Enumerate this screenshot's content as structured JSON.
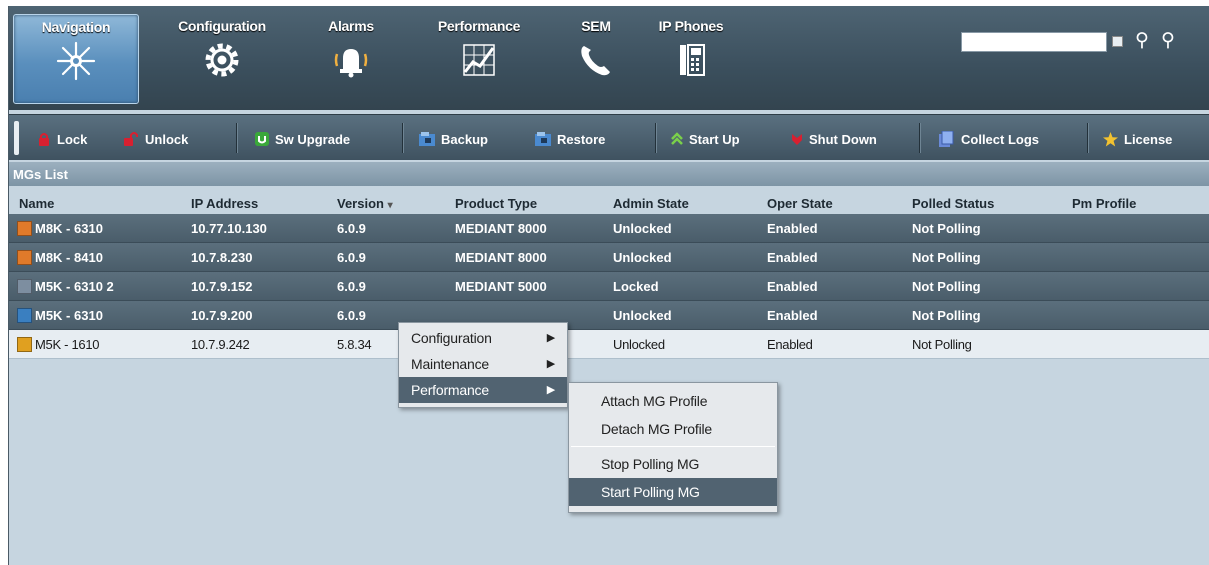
{
  "nav": {
    "tabs": [
      {
        "label": "Navigation",
        "icon": "network-star-icon",
        "active": true
      },
      {
        "label": "Configuration",
        "icon": "gear-icon",
        "active": false
      },
      {
        "label": "Alarms",
        "icon": "alarm-bell-icon",
        "active": false
      },
      {
        "label": "Performance",
        "icon": "performance-chart-icon",
        "active": false
      },
      {
        "label": "SEM",
        "icon": "phone-handset-icon",
        "active": false
      },
      {
        "label": "IP Phones",
        "icon": "ip-phone-icon",
        "active": false
      }
    ],
    "search": {
      "value": "",
      "placeholder": ""
    }
  },
  "toolbar": {
    "buttons": [
      {
        "label": "Lock",
        "icon": "lock-icon"
      },
      {
        "label": "Unlock",
        "icon": "unlock-icon"
      },
      {
        "label": "Sw Upgrade",
        "icon": "sw-upgrade-icon"
      },
      {
        "label": "Backup",
        "icon": "backup-icon"
      },
      {
        "label": "Restore",
        "icon": "restore-icon"
      },
      {
        "label": "Start Up",
        "icon": "start-up-icon"
      },
      {
        "label": "Shut Down",
        "icon": "shut-down-icon"
      },
      {
        "label": "Collect Logs",
        "icon": "collect-logs-icon"
      },
      {
        "label": "License",
        "icon": "license-star-icon"
      }
    ]
  },
  "list": {
    "title": "MGs List",
    "sort_indicator": "▾",
    "columns": [
      "Name",
      "IP Address",
      "Version",
      "Product Type",
      "Admin State",
      "Oper State",
      "Polled Status",
      "Pm Profile"
    ],
    "rows": [
      {
        "name": "M8K - 6310",
        "ip": "10.77.10.130",
        "version": "6.0.9",
        "product": "MEDIANT 8000",
        "admin": "Unlocked",
        "oper": "Enabled",
        "polled": "Not Polling",
        "pm": "",
        "selected": true,
        "icon_color": "#e07a2a"
      },
      {
        "name": "M8K - 8410",
        "ip": "10.7.8.230",
        "version": "6.0.9",
        "product": "MEDIANT 8000",
        "admin": "Unlocked",
        "oper": "Enabled",
        "polled": "Not Polling",
        "pm": "",
        "selected": true,
        "icon_color": "#e07a2a"
      },
      {
        "name": "M5K - 6310 2",
        "ip": "10.7.9.152",
        "version": "6.0.9",
        "product": "MEDIANT 5000",
        "admin": "Locked",
        "oper": "Enabled",
        "polled": "Not Polling",
        "pm": "",
        "selected": true,
        "icon_color": "#7d8ea0"
      },
      {
        "name": "M5K - 6310",
        "ip": "10.7.9.200",
        "version": "6.0.9",
        "product": "",
        "admin": "Unlocked",
        "oper": "Enabled",
        "polled": "Not Polling",
        "pm": "",
        "selected": true,
        "icon_color": "#3a7fc0"
      },
      {
        "name": "M5K - 1610",
        "ip": "10.7.9.242",
        "version": "5.8.34",
        "product": "",
        "admin": "Unlocked",
        "oper": "Enabled",
        "polled": "Not Polling",
        "pm": "",
        "selected": false,
        "icon_color": "#e0a020"
      }
    ]
  },
  "context_menu": {
    "items": [
      {
        "label": "Configuration",
        "arrow": "▶"
      },
      {
        "label": "Maintenance",
        "arrow": "▶"
      },
      {
        "label": "Performance",
        "arrow": "▶"
      }
    ]
  },
  "submenu": {
    "items": [
      "Attach MG Profile",
      "Detach MG Profile",
      "Stop Polling MG",
      "Start Polling MG"
    ]
  }
}
